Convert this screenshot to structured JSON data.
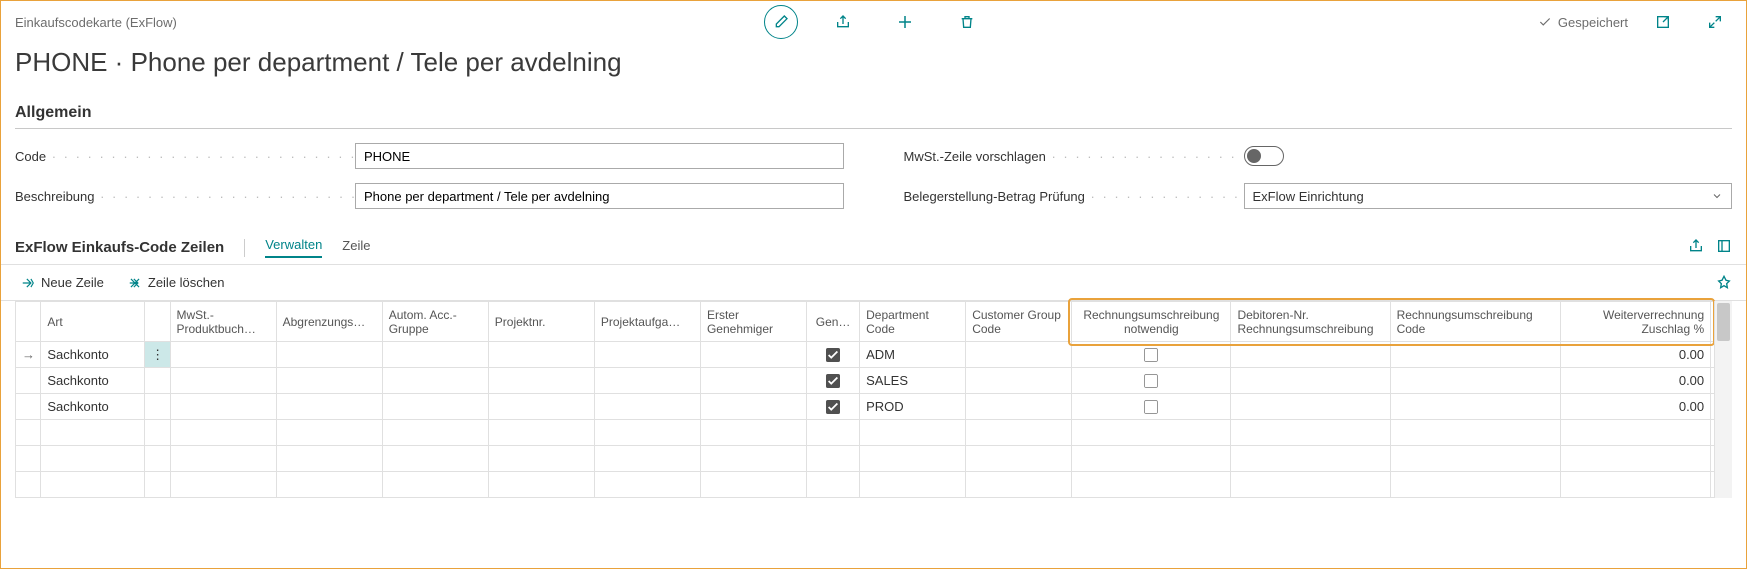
{
  "header": {
    "breadcrumb": "Einkaufscodekarte (ExFlow)",
    "saved_label": "Gespeichert",
    "page_title": "PHONE · Phone per department / Tele per avdelning"
  },
  "general": {
    "section_title": "Allgemein",
    "code_label": "Code",
    "code_value": "PHONE",
    "description_label": "Beschreibung",
    "description_value": "Phone per department / Tele per avdelning",
    "vat_suggest_label": "MwSt.-Zeile vorschlagen",
    "doc_amount_label": "Belegerstellung-Betrag Prüfung",
    "doc_amount_value": "ExFlow Einrichtung"
  },
  "lines": {
    "section_title": "ExFlow Einkaufs-Code Zeilen",
    "tab_manage": "Verwalten",
    "tab_line": "Zeile",
    "new_line": "Neue Zeile",
    "delete_line": "Zeile löschen",
    "columns": {
      "art": "Art",
      "vat_prod": "MwSt.-Produktbuch…",
      "deferral": "Abgrenzungs…",
      "autoacc": "Autom. Acc.-Gruppe",
      "projectno": "Projektnr.",
      "projecttask": "Projektaufga…",
      "firstapprover": "Erster Genehmiger",
      "approved": "Gen…",
      "deptcode": "Department Code",
      "custgroup": "Customer Group Code",
      "reinv_req": "Rechnungsumschreibung notwendig",
      "debitor": "Debitoren-Nr. Rechnungsumschreibung",
      "reinv_code": "Rechnungsumschreibung Code",
      "surcharge": "Weiterverrechnung Zuschlag %"
    },
    "rows": [
      {
        "art": "Sachkonto",
        "approved": true,
        "dept": "ADM",
        "reinv_req": false,
        "surcharge": "0.00",
        "selected": true
      },
      {
        "art": "Sachkonto",
        "approved": true,
        "dept": "SALES",
        "reinv_req": false,
        "surcharge": "0.00",
        "selected": false
      },
      {
        "art": "Sachkonto",
        "approved": true,
        "dept": "PROD",
        "reinv_req": false,
        "surcharge": "0.00",
        "selected": false
      }
    ]
  }
}
